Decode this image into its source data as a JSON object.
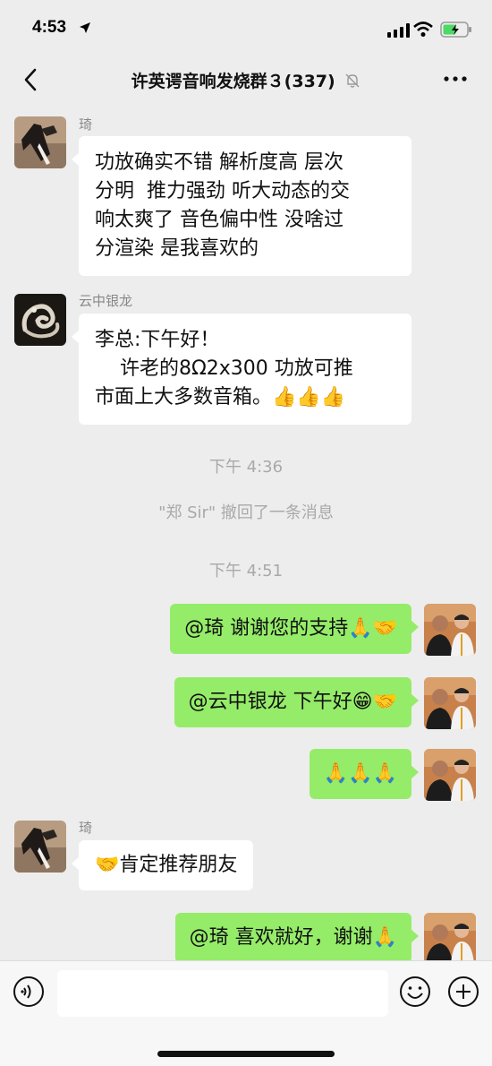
{
  "status": {
    "time": "4:53"
  },
  "nav": {
    "title": "许英谔音响发烧群３(337)"
  },
  "messages": {
    "m1": {
      "sender": "琦",
      "text": "功放确实不错 解析度高 层次\n分明  推力强劲 听大动态的交\n响太爽了 音色偏中性 没啥过\n分渲染 是我喜欢的"
    },
    "m2": {
      "sender": "云中银龙",
      "text": "李总:下午好！\n    许老的8Ω2x300 功放可推\n市面上大多数音箱。",
      "emoji": "👍👍👍"
    },
    "t1": "下午 4:36",
    "sys1": "\"郑 Sir\" 撤回了一条消息",
    "t2": "下午 4:51",
    "m3": {
      "text": "@琦 谢谢您的支持",
      "emoji": "🙏🤝"
    },
    "m4": {
      "text": "@云中银龙 下午好",
      "emoji": "😁🤝"
    },
    "m5": {
      "emoji": "🙏🙏🙏"
    },
    "m6": {
      "sender": "琦",
      "emoji": "🤝",
      "text": "肯定推荐朋友"
    },
    "m7": {
      "text": "@琦 喜欢就好，谢谢",
      "emoji": "🙏"
    }
  },
  "input": {
    "placeholder": ""
  },
  "icons": {
    "back": "chevron-left-icon",
    "more": "more-dots-icon",
    "mute": "bell-muted-icon",
    "voice": "voice-icon",
    "emoji": "emoji-icon",
    "plus": "plus-icon"
  }
}
